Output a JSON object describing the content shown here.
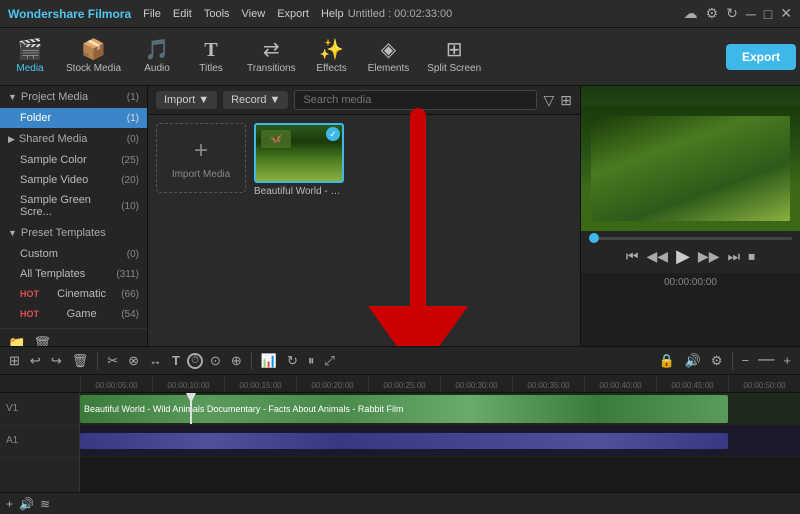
{
  "app": {
    "name": "Wondershare Filmora",
    "title": "Untitled : 00:02:33:00"
  },
  "menubar": {
    "items": [
      "File",
      "Edit",
      "Tools",
      "View",
      "Export",
      "Help"
    ]
  },
  "toolbar": {
    "items": [
      {
        "id": "media",
        "label": "Media",
        "icon": "🎬",
        "active": true
      },
      {
        "id": "stock-media",
        "label": "Stock Media",
        "icon": "📦",
        "active": false
      },
      {
        "id": "audio",
        "label": "Audio",
        "icon": "🎵",
        "active": false
      },
      {
        "id": "titles",
        "label": "Titles",
        "icon": "T",
        "active": false
      },
      {
        "id": "transitions",
        "label": "Transitions",
        "icon": "⟺",
        "active": false
      },
      {
        "id": "effects",
        "label": "Effects",
        "icon": "✨",
        "active": false
      },
      {
        "id": "elements",
        "label": "Elements",
        "icon": "◈",
        "active": false
      },
      {
        "id": "split-screen",
        "label": "Split Screen",
        "icon": "⊞",
        "active": false
      }
    ],
    "export_label": "Export"
  },
  "sidebar": {
    "sections": [
      {
        "id": "project-media",
        "label": "Project Media",
        "count": "(1)",
        "expanded": true,
        "items": [
          {
            "id": "folder",
            "label": "Folder",
            "count": "(1)",
            "active": true
          }
        ]
      },
      {
        "id": "shared-media",
        "label": "Shared Media",
        "count": "(0)",
        "expanded": false,
        "items": []
      },
      {
        "id": "sample-color",
        "label": "Sample Color",
        "count": "(25)",
        "expanded": false,
        "items": []
      },
      {
        "id": "sample-video",
        "label": "Sample Video",
        "count": "(20)",
        "expanded": false,
        "items": []
      },
      {
        "id": "sample-green",
        "label": "Sample Green Scre...",
        "count": "(10)",
        "expanded": false,
        "items": []
      },
      {
        "id": "preset-templates",
        "label": "Preset Templates",
        "count": "",
        "expanded": true,
        "items": [
          {
            "id": "custom",
            "label": "Custom",
            "count": "(0)",
            "active": false
          },
          {
            "id": "all-templates",
            "label": "All Templates",
            "count": "(311)",
            "active": false
          },
          {
            "id": "cinematic",
            "label": "Cinematic",
            "count": "(66)",
            "active": false,
            "badge": "HOT"
          },
          {
            "id": "game",
            "label": "Game",
            "count": "(54)",
            "active": false,
            "badge": "HOT"
          }
        ]
      }
    ]
  },
  "media_toolbar": {
    "import_label": "Import",
    "record_label": "Record",
    "search_placeholder": "Search media"
  },
  "media_grid": {
    "import_label": "Import Media",
    "items": [
      {
        "id": "beautiful-world",
        "label": "Beautiful World - Wild A...",
        "selected": true
      }
    ]
  },
  "preview": {
    "time": "00:00:00:00"
  },
  "timeline": {
    "toolbar_buttons": [
      "⊞",
      "↩",
      "↪",
      "🗑",
      "✂",
      "⊗",
      "↔",
      "T",
      "⏱",
      "⊙",
      "⊕",
      "↕",
      "📊",
      "↻",
      "⏸",
      "⤢",
      "🔊",
      "⚙"
    ],
    "ruler_marks": [
      "00:00:05:00",
      "00:00:10:00",
      "00:00:15:00",
      "00:00:20:00",
      "00:00:25:00",
      "00:00:30:00",
      "00:00:35:00",
      "00:00:40:00",
      "00:00:45:00",
      "00:00:50:00"
    ],
    "tracks": [
      {
        "id": "video",
        "label": "V1",
        "type": "video"
      },
      {
        "id": "audio",
        "label": "A1",
        "type": "audio"
      }
    ],
    "clip_label": "Beautiful World - Wild Animals Documentary - Facts About Animals - Rabbit Film"
  },
  "colors": {
    "accent": "#3db8e8",
    "active_sidebar": "#3a86c8",
    "export_bg": "#3db8e8",
    "red_arrow": "#cc0000"
  }
}
